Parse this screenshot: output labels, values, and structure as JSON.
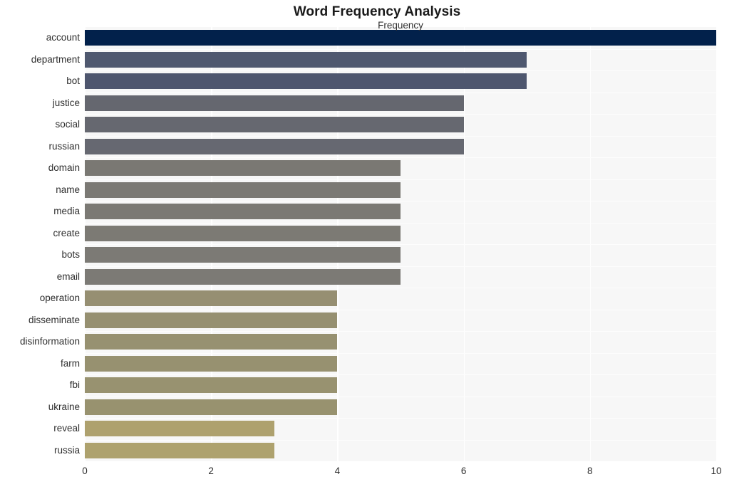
{
  "chart_data": {
    "type": "bar",
    "orientation": "horizontal",
    "title": "Word Frequency Analysis",
    "xlabel": "Frequency",
    "ylabel": "",
    "xlim": [
      0,
      10
    ],
    "xticks": [
      0,
      2,
      4,
      6,
      8,
      10
    ],
    "xtick_labels": [
      "0",
      "2",
      "4",
      "6",
      "8",
      "10"
    ],
    "grid": true,
    "legend": "none",
    "categories": [
      "account",
      "department",
      "bot",
      "justice",
      "social",
      "russian",
      "domain",
      "name",
      "media",
      "create",
      "bots",
      "email",
      "operation",
      "disseminate",
      "disinformation",
      "farm",
      "fbi",
      "ukraine",
      "reveal",
      "russia"
    ],
    "values": [
      10,
      7,
      7,
      6,
      6,
      6,
      5,
      5,
      5,
      5,
      5,
      5,
      4,
      4,
      4,
      4,
      4,
      4,
      3,
      3
    ],
    "bar_colors": [
      "#02214b",
      "#4f586f",
      "#4e566e",
      "#65676f",
      "#666870",
      "#666871",
      "#7a7873",
      "#7b7974",
      "#7b7974",
      "#7c7a74",
      "#7c7a75",
      "#7c7a75",
      "#968f72",
      "#969071",
      "#979171",
      "#979170",
      "#989270",
      "#98926f",
      "#aea16e",
      "#aea26e"
    ],
    "plot_background": "#f7f7f7",
    "gridline_color": "#ffffff",
    "page_background": "#ffffff",
    "text_color": "#2f2f2f",
    "title_color": "#1a1a1a"
  }
}
